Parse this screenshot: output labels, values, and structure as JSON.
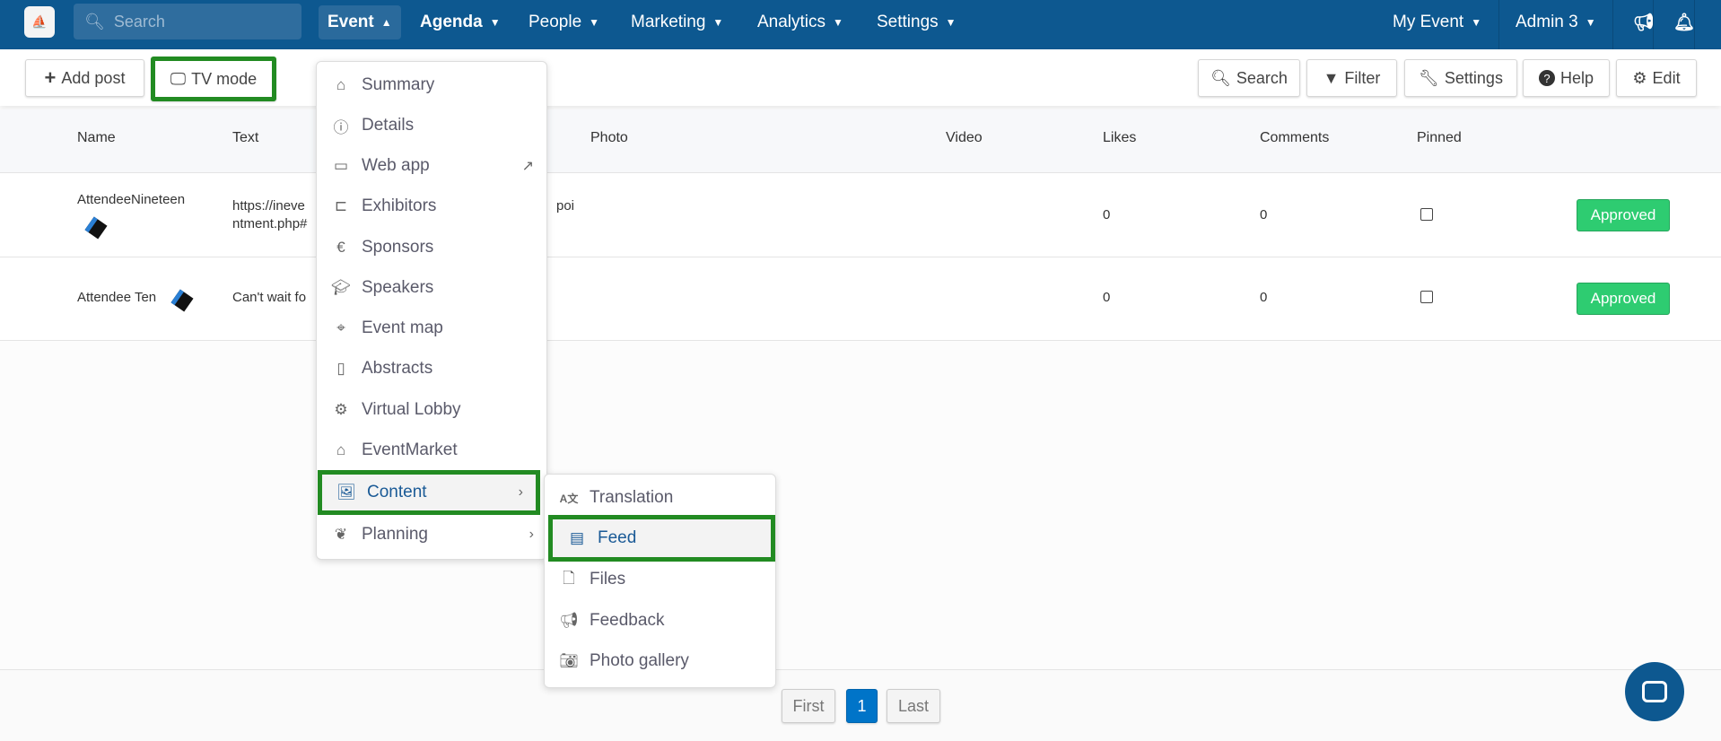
{
  "nav": {
    "search_placeholder": "Search",
    "items": [
      "Event",
      "Agenda",
      "People",
      "Marketing",
      "Analytics",
      "Settings"
    ],
    "my_event": "My Event",
    "admin": "Admin 3"
  },
  "toolbar": {
    "add_post": "Add post",
    "tv_mode": "TV mode",
    "search": "Search",
    "filter": "Filter",
    "settings": "Settings",
    "help": "Help",
    "edit": "Edit"
  },
  "table": {
    "headers": [
      "Name",
      "Text",
      "Photo",
      "Video",
      "Likes",
      "Comments",
      "Pinned"
    ],
    "rows": [
      {
        "name": "AttendeeNineteen",
        "text1": "https://ineve",
        "text2": "ntment.php#",
        "text_tail": "poi",
        "likes": "0",
        "comments": "0",
        "status": "Approved"
      },
      {
        "name": "Attendee Ten",
        "text1": "Can't wait fo",
        "likes": "0",
        "comments": "0",
        "status": "Approved"
      }
    ]
  },
  "event_menu": [
    "Summary",
    "Details",
    "Web app",
    "Exhibitors",
    "Sponsors",
    "Speakers",
    "Event map",
    "Abstracts",
    "Virtual Lobby",
    "EventMarket",
    "Content",
    "Planning"
  ],
  "content_menu": [
    "Translation",
    "Feed",
    "Files",
    "Feedback",
    "Photo gallery"
  ],
  "pagination": {
    "first": "First",
    "current": "1",
    "last": "Last"
  },
  "colors": {
    "nav": "#0d5890",
    "highlight": "#228b22",
    "approved": "#2ecc71",
    "page_active": "#0074c8"
  }
}
